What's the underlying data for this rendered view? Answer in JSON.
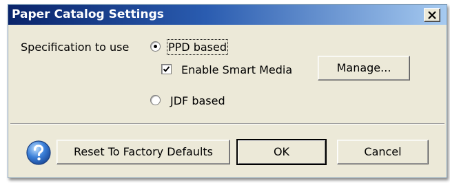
{
  "dialog": {
    "title": "Paper Catalog Settings",
    "close_icon": "close-icon"
  },
  "specification": {
    "label": "Specification to use",
    "options": [
      {
        "label": "PPD based",
        "selected": true
      },
      {
        "label": "JDF based",
        "selected": false
      }
    ],
    "smart_media": {
      "label": "Enable Smart Media",
      "checked": true
    },
    "manage_label": "Manage..."
  },
  "footer": {
    "help_icon": "help-icon",
    "reset_label": "Reset To Factory Defaults",
    "ok_label": "OK",
    "cancel_label": "Cancel"
  },
  "colors": {
    "title_bar_start": "#0a246a",
    "title_bar_end": "#a6caf0",
    "dialog_face": "#ece9d8",
    "help_icon_blue": "#2f6fc8"
  }
}
